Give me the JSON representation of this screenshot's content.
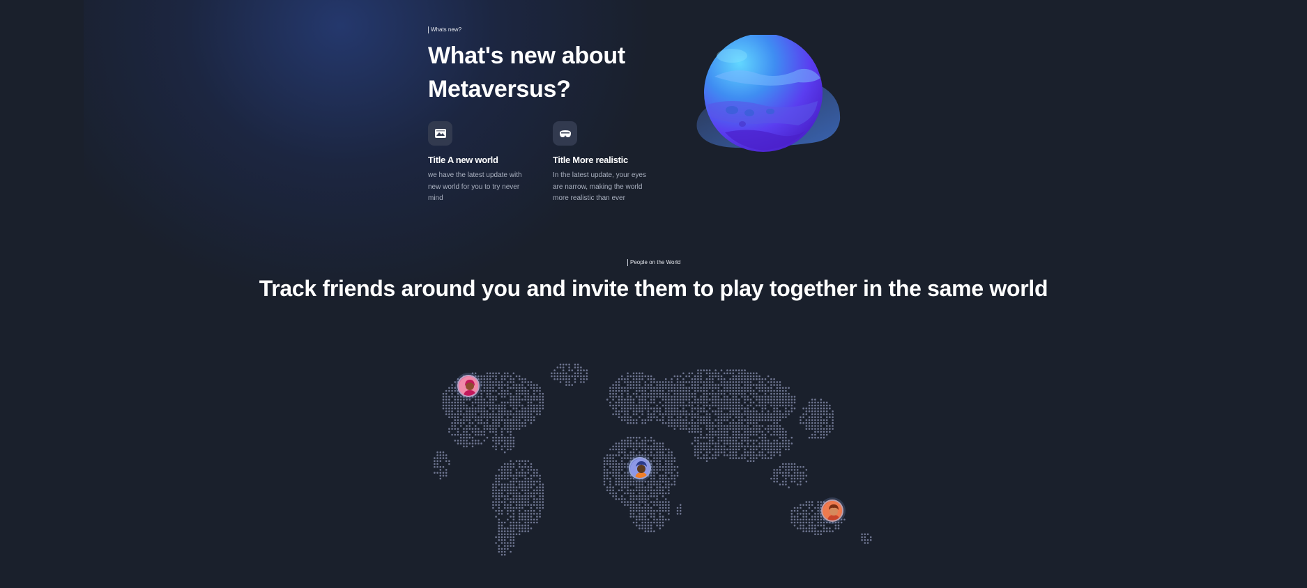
{
  "whats_new": {
    "eyebrow": "Whats new?",
    "title": "What's new about Metaversus?",
    "features": [
      {
        "icon": "image-icon",
        "title": "Title A new world",
        "description": "we have the latest update with new world for you to try never mind"
      },
      {
        "icon": "vr-headset-icon",
        "title": "Title More realistic",
        "description": "In the latest update, your eyes are narrow, making the world more realistic than ever"
      }
    ]
  },
  "people": {
    "eyebrow": "People on the World",
    "title": "Track friends around you and invite them to play together in the same world",
    "avatars": [
      {
        "name": "pink-haired-person-avatar",
        "color": "#e0528a"
      },
      {
        "name": "blue-haired-person-avatar",
        "color": "#5b63c9"
      },
      {
        "name": "orange-haired-person-avatar",
        "color": "#e8643c"
      }
    ]
  },
  "colors": {
    "background": "#1a202c",
    "planet_primary": "#5b3df0",
    "planet_highlight": "#4fc3f7",
    "map_dot": "#6f7691"
  }
}
